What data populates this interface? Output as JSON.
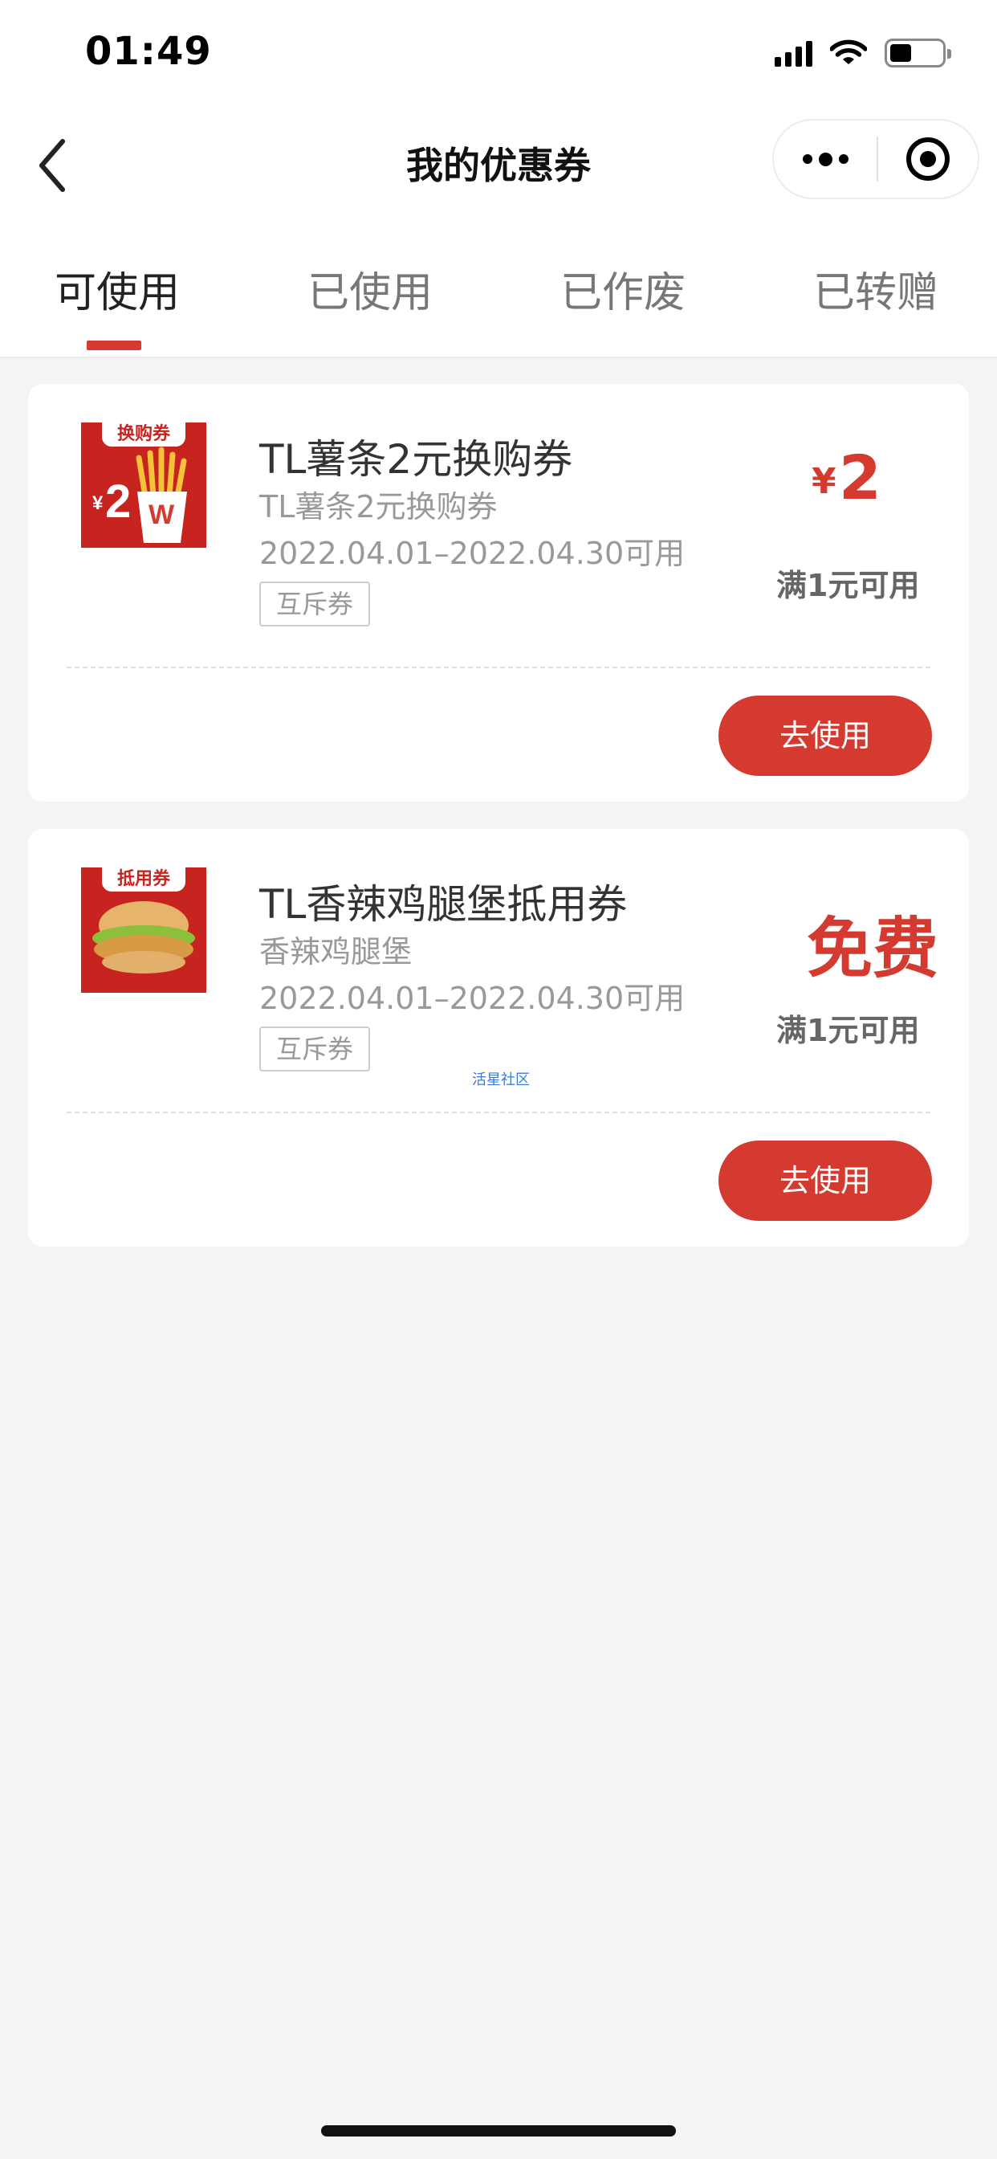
{
  "status_bar": {
    "time": "01:49"
  },
  "header": {
    "title": "我的优惠券"
  },
  "tabs": [
    {
      "label": "可使用",
      "active": true
    },
    {
      "label": "已使用",
      "active": false
    },
    {
      "label": "已作废",
      "active": false
    },
    {
      "label": "已转赠",
      "active": false
    }
  ],
  "coupons": [
    {
      "image_tag": "换购券",
      "title": "TL薯条2元换购券",
      "subtitle": "TL薯条2元换购券",
      "validity": "2022.04.01–2022.04.30可用",
      "badge": "互斥券",
      "price_symbol": "¥",
      "price": "2",
      "condition": "满1元可用",
      "button": "去使用"
    },
    {
      "image_tag": "抵用券",
      "title": "TL香辣鸡腿堡抵用券",
      "subtitle": "香辣鸡腿堡",
      "validity": "2022.04.01–2022.04.30可用",
      "badge": "互斥券",
      "price": "免费",
      "condition": "满1元可用",
      "button": "去使用"
    }
  ],
  "watermark": "活星社区",
  "colors": {
    "accent": "#d53a30",
    "background": "#f4f4f4"
  }
}
